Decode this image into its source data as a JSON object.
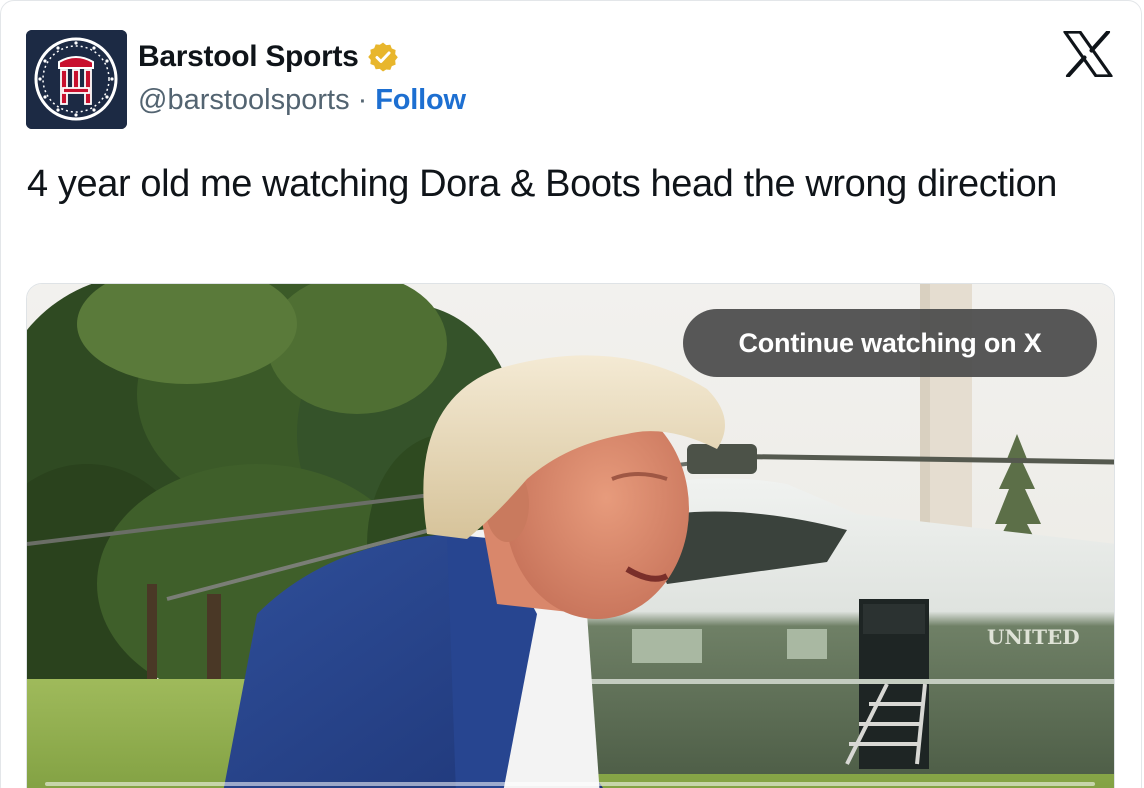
{
  "tweet": {
    "author": {
      "display_name": "Barstool Sports",
      "handle": "@barstoolsports",
      "separator": "·",
      "verified": true,
      "verified_color": "#e8b62c",
      "avatar_bg": "#1c2a44",
      "avatar_accent": "#c8102e"
    },
    "follow_label": "Follow",
    "follow_color": "#1d6fd1",
    "text": "4 year old me watching Dora & Boots head the wrong direction",
    "media": {
      "type": "video",
      "continue_label": "Continue watching on X",
      "helicopter_text": "UNITED"
    },
    "close_icon": "x-logo-icon"
  }
}
